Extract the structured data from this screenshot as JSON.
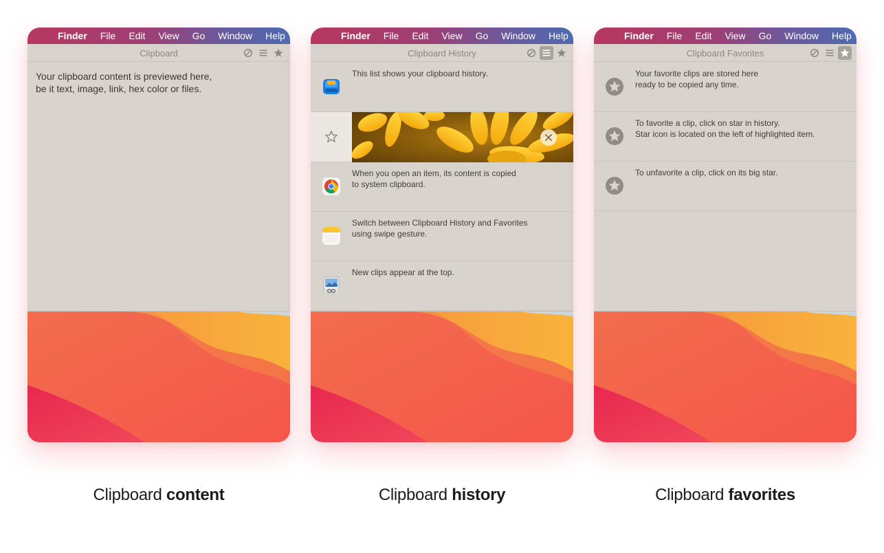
{
  "menubar": {
    "items": [
      "Finder",
      "File",
      "Edit",
      "View",
      "Go",
      "Window",
      "Help"
    ]
  },
  "panels": {
    "content": {
      "title": "Clipboard",
      "text": "Your clipboard content is previewed here,\nbe it text, image, link, hex color or files.",
      "caption_regular": "Clipboard ",
      "caption_bold": "content"
    },
    "history": {
      "title": "Clipboard History",
      "rows": [
        {
          "text": "This list shows your clipboard history.",
          "icon": "finder-disk-icon"
        },
        {
          "text": "",
          "icon": "flower-image"
        },
        {
          "text": "When you open an item, its content is copied\nto system clipboard.",
          "icon": "chrome-icon"
        },
        {
          "text": "Switch between Clipboard History and Favorites\nusing swipe gesture.",
          "icon": "notes-icon"
        },
        {
          "text": "New clips appear at the top.",
          "icon": "preview-icon"
        }
      ],
      "caption_regular": "Clipboard ",
      "caption_bold": "history"
    },
    "favorites": {
      "title": "Clipboard Favorites",
      "rows": [
        {
          "text": "Your favorite clips are stored here\nready to be copied any time."
        },
        {
          "text": "To favorite a clip, click on star in history.\nStar icon is located on the left of highlighted item."
        },
        {
          "text": "To unfavorite a clip, click on its big star."
        }
      ],
      "caption_regular": "Clipboard ",
      "caption_bold": "favorites"
    }
  },
  "colors": {
    "window_bg": "#d8d3cc",
    "highlight_row": "#ebe8e4",
    "wallpaper_red": "#f0415a",
    "wallpaper_orange": "#f7a63a"
  }
}
